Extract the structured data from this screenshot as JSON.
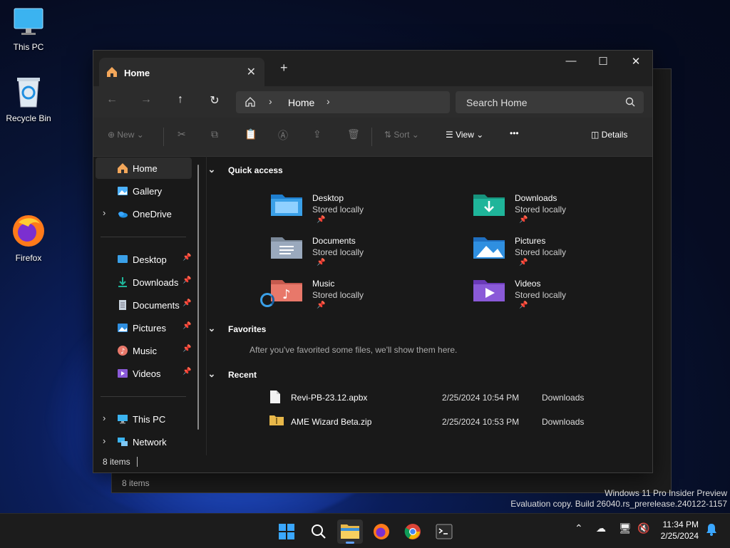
{
  "desktop": {
    "icons": [
      {
        "label": "This PC",
        "icon": "monitor-icon"
      },
      {
        "label": "Recycle Bin",
        "icon": "recycle-bin-icon"
      },
      {
        "label": "Firefox",
        "icon": "firefox-icon"
      }
    ],
    "watermark_line1": "Windows 11 Pro Insider Preview",
    "watermark_line2": "Evaluation copy. Build 26040.rs_prerelease.240122-1157"
  },
  "background_window": {
    "status": "8 items"
  },
  "window": {
    "tab_title": "Home",
    "new_tab": "+",
    "controls": {
      "minimize": "—",
      "maximize": "☐",
      "close": "✕"
    }
  },
  "navbar": {
    "back": "←",
    "forward": "→",
    "up": "↑",
    "refresh": "↻",
    "breadcrumb": "Home",
    "search_placeholder": "Search Home"
  },
  "toolbar": {
    "new_label": "New",
    "sort_label": "Sort",
    "view_label": "View",
    "more_label": "•••",
    "details_label": "Details"
  },
  "sidebar": {
    "top": [
      {
        "label": "Home",
        "icon": "home-icon",
        "selected": true
      },
      {
        "label": "Gallery",
        "icon": "gallery-icon"
      },
      {
        "label": "OneDrive",
        "icon": "onedrive-icon",
        "expandable": true
      }
    ],
    "pinned": [
      {
        "label": "Desktop",
        "icon": "desktop-folder-icon"
      },
      {
        "label": "Downloads",
        "icon": "downloads-icon"
      },
      {
        "label": "Documents",
        "icon": "documents-icon"
      },
      {
        "label": "Pictures",
        "icon": "pictures-icon"
      },
      {
        "label": "Music",
        "icon": "music-icon"
      },
      {
        "label": "Videos",
        "icon": "videos-icon"
      }
    ],
    "bottom": [
      {
        "label": "This PC",
        "icon": "this-pc-icon"
      },
      {
        "label": "Network",
        "icon": "network-icon"
      }
    ]
  },
  "main": {
    "quick_access_title": "Quick access",
    "quick_access": [
      {
        "name": "Desktop",
        "sub": "Stored locally",
        "color": "#3aa0e8"
      },
      {
        "name": "Downloads",
        "sub": "Stored locally",
        "color": "#1fb59a"
      },
      {
        "name": "Documents",
        "sub": "Stored locally",
        "color": "#9aa9bd"
      },
      {
        "name": "Pictures",
        "sub": "Stored locally",
        "color": "#2f8fe0"
      },
      {
        "name": "Music",
        "sub": "Stored locally",
        "color": "#e8786a"
      },
      {
        "name": "Videos",
        "sub": "Stored locally",
        "color": "#8a5ad8"
      }
    ],
    "favorites_title": "Favorites",
    "favorites_empty": "After you've favorited some files, we'll show them here.",
    "recent_title": "Recent",
    "recent": [
      {
        "name": "Revi-PB-23.12.apbx",
        "date": "2/25/2024 10:54 PM",
        "location": "Downloads"
      },
      {
        "name": "AME Wizard Beta.zip",
        "date": "2/25/2024 10:53 PM",
        "location": "Downloads"
      }
    ]
  },
  "status": {
    "count": "8 items"
  },
  "taskbar": {
    "time": "11:34 PM",
    "date": "2/25/2024",
    "accent": "#60a0ff"
  }
}
